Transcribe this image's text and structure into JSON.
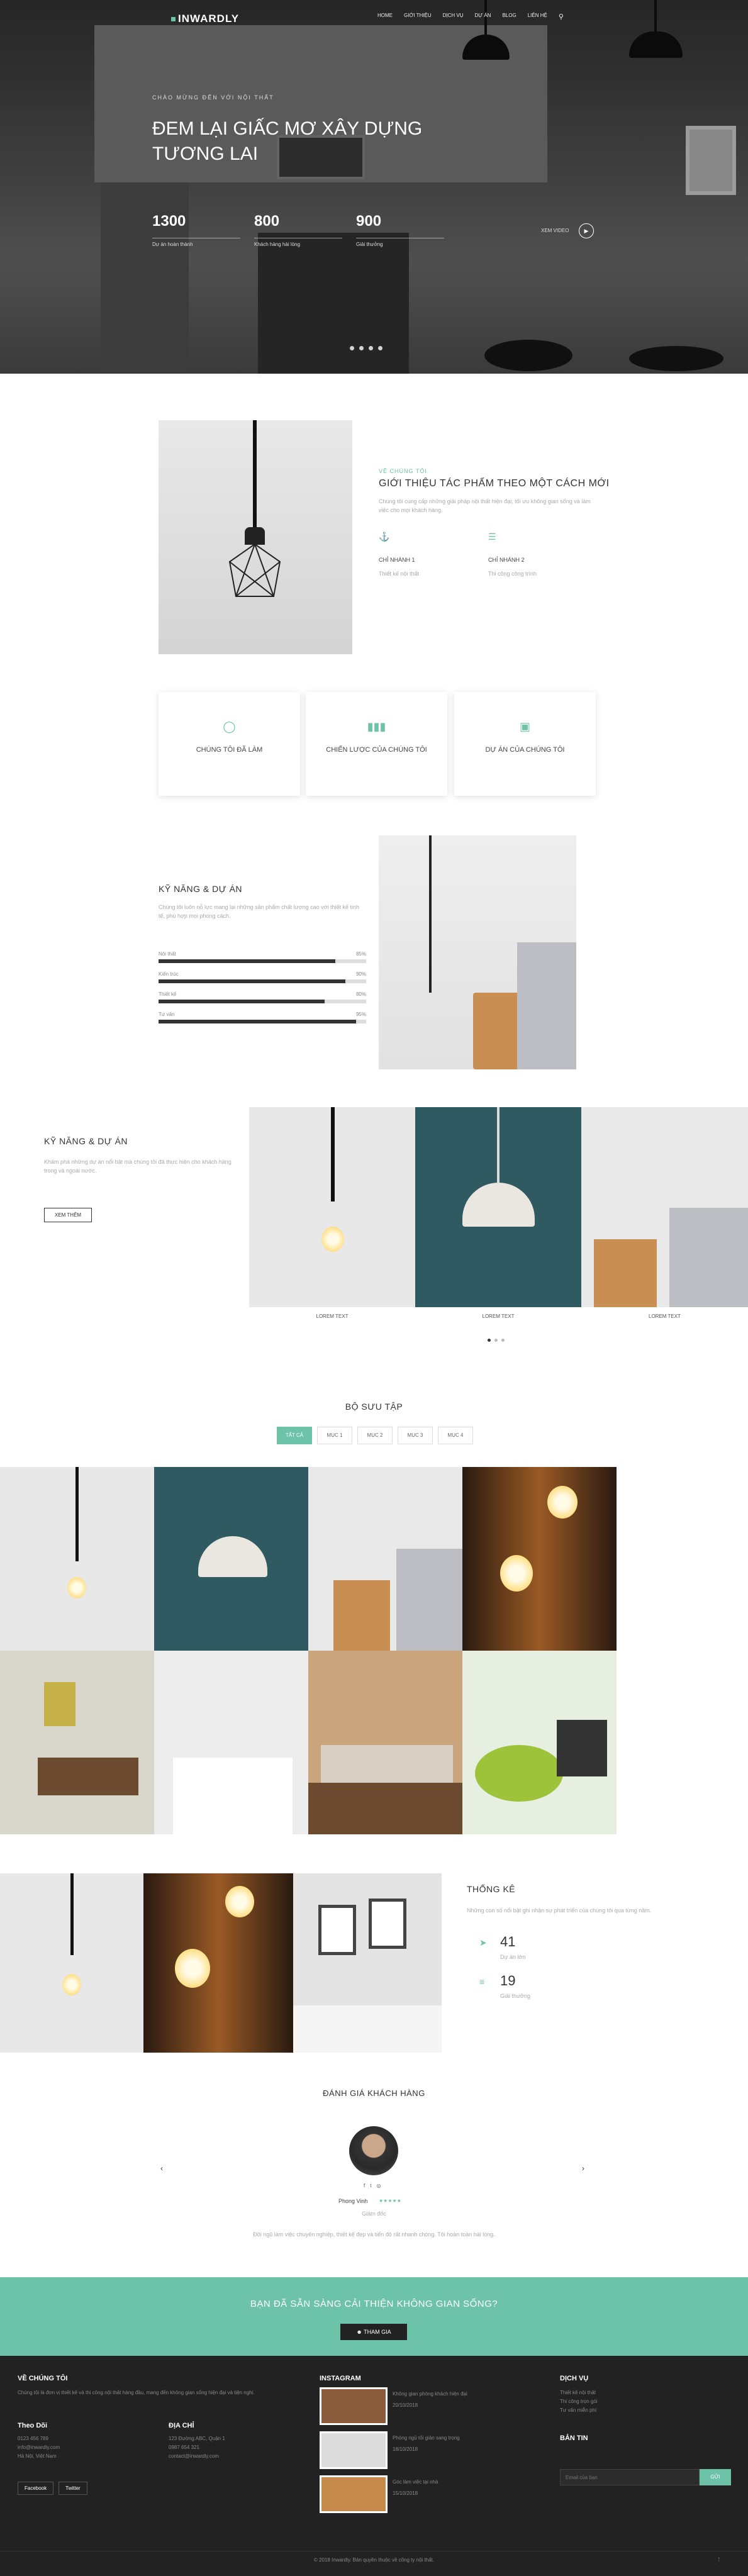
{
  "brand": {
    "name": "INWARDLY",
    "accent": "#6cc3a7"
  },
  "nav": {
    "items": [
      "HOME",
      "GIỚI THIỆU",
      "DỊCH VỤ",
      "DỰ ÁN",
      "BLOG",
      "LIÊN HỆ"
    ]
  },
  "hero": {
    "kicker": "CHÀO MỪNG ĐẾN VỚI NỘI THẤT",
    "title": "ĐEM LẠI GIẤC MƠ XÂY DỰNG TƯƠNG LAI",
    "stats": [
      {
        "num": "1300",
        "label": "Dự án hoàn thành"
      },
      {
        "num": "800",
        "label": "Khách hàng hài lòng"
      },
      {
        "num": "900",
        "label": "Giải thưởng"
      }
    ],
    "video_label": "XEM VIDEO"
  },
  "about": {
    "kicker": "VỀ CHÚNG TÔI",
    "title": "GIỚI THIỆU TÁC PHẨM THEO MỘT CÁCH MỚI",
    "text": "Chúng tôi cung cấp những giải pháp nội thất hiện đại, tối ưu không gian sống và làm việc cho mọi khách hàng.",
    "features": [
      {
        "title": "CHỈ NHÁNH 1",
        "text": "Thiết kế nội thất"
      },
      {
        "title": "CHỈ NHÁNH 2",
        "text": "Thi công công trình"
      }
    ]
  },
  "cards": [
    {
      "icon": "bulb-icon",
      "label": "CHÚNG TÔI ĐÃ LÀM"
    },
    {
      "icon": "chart-icon",
      "label": "CHIẾN LƯỢC CỦA CHÚNG TÔI"
    },
    {
      "icon": "folder-icon",
      "label": "DỰ ÁN CỦA CHÚNG TÔI"
    }
  ],
  "skills": {
    "title": "KỸ NĂNG & DỰ ÁN",
    "text": "Chúng tôi luôn nỗ lực mang lại những sản phẩm chất lượng cao với thiết kế tinh tế, phù hợp mọi phong cách.",
    "bars": [
      {
        "name": "Nội thất",
        "value": "85%",
        "pct": 85
      },
      {
        "name": "Kiến trúc",
        "value": "90%",
        "pct": 90
      },
      {
        "name": "Thiết kế",
        "value": "80%",
        "pct": 80
      },
      {
        "name": "Tư vấn",
        "value": "95%",
        "pct": 95
      }
    ]
  },
  "projects": {
    "title": "KỸ NĂNG & DỰ ÁN",
    "text": "Khám phá những dự án nổi bật mà chúng tôi đã thực hiện cho khách hàng trong và ngoài nước.",
    "button": "XEM THÊM",
    "captions": [
      "LOREM TEXT",
      "LOREM TEXT",
      "LOREM TEXT"
    ]
  },
  "collection": {
    "title": "BỘ SƯU TẬP",
    "tabs": [
      "TẤT CẢ",
      "MỤC 1",
      "MỤC 2",
      "MỤC 3",
      "MỤC 4"
    ]
  },
  "stats": {
    "title": "THỐNG KÊ",
    "text": "Những con số nổi bật ghi nhận sự phát triển của chúng tôi qua từng năm.",
    "items": [
      {
        "num": "41",
        "label": "Dự án lớn"
      },
      {
        "num": "19",
        "label": "Giải thưởng"
      }
    ]
  },
  "testimonial": {
    "title": "ĐÁNH GIÁ KHÁCH HÀNG",
    "name": "Phong Vinh",
    "role": "Giám đốc",
    "quote": "Đội ngũ làm việc chuyên nghiệp, thiết kế đẹp và tiến độ rất nhanh chóng. Tôi hoàn toàn hài lòng."
  },
  "cta": {
    "text": "BẠN ĐÃ SẴN SÀNG CẢI THIỆN KHÔNG GIAN SỐNG?",
    "button": "THAM GIA"
  },
  "footer": {
    "about_title": "VỀ CHÚNG TÔI",
    "about_text": "Chúng tôi là đơn vị thiết kế và thi công nội thất hàng đầu, mang đến không gian sống hiện đại và tiện nghi.",
    "contact_title": "Theo Dõi",
    "contact": [
      "0123 456 789",
      "info@inwardly.com",
      "Hà Nội, Việt Nam"
    ],
    "address_title": "ĐỊA CHỈ",
    "address": [
      "123 Đường ABC, Quận 1",
      "0987 654 321",
      "contact@inwardly.com"
    ],
    "social": [
      "Facebook",
      "Twitter"
    ],
    "insta_title": "INSTAGRAM",
    "insta": [
      {
        "title": "Không gian phòng khách hiện đại",
        "date": "20/10/2018"
      },
      {
        "title": "Phòng ngủ tối giản sang trọng",
        "date": "18/10/2018"
      },
      {
        "title": "Góc làm việc tại nhà",
        "date": "15/10/2018"
      }
    ],
    "service_title": "DỊCH VỤ",
    "services": [
      "Thiết kế nội thất",
      "Thi công trọn gói",
      "Tư vấn miễn phí"
    ],
    "news_title": "BẢN TIN",
    "news_placeholder": "Email của bạn",
    "news_button": "GỬI",
    "copyright": "© 2018 Inwardly. Bản quyền thuộc về công ty nội thất."
  }
}
